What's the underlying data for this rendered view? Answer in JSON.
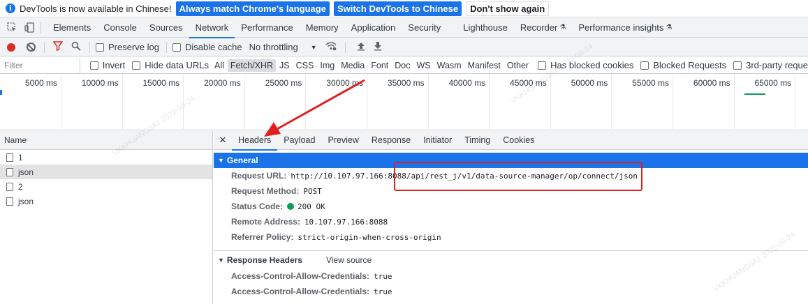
{
  "infobar": {
    "message": "DevTools is now available in Chinese!",
    "btn_match": "Always match Chrome's language",
    "btn_switch": "Switch DevTools to Chinese",
    "btn_dismiss": "Don't show again"
  },
  "tabs": [
    "Elements",
    "Console",
    "Sources",
    "Network",
    "Performance",
    "Memory",
    "Application",
    "Security",
    "Lighthouse",
    "Recorder",
    "Performance insights"
  ],
  "toolbar": {
    "preserve_log": "Preserve log",
    "disable_cache": "Disable cache",
    "throttling": "No throttling"
  },
  "filter": {
    "placeholder": "Filter",
    "invert": "Invert",
    "hide_data_urls": "Hide data URLs",
    "types": [
      "All",
      "Fetch/XHR",
      "JS",
      "CSS",
      "Img",
      "Media",
      "Font",
      "Doc",
      "WS",
      "Wasm",
      "Manifest",
      "Other"
    ],
    "has_blocked_cookies": "Has blocked cookies",
    "blocked_requests": "Blocked Requests",
    "third_party": "3rd-party reque"
  },
  "timeline": {
    "ticks": [
      "5000 ms",
      "10000 ms",
      "15000 ms",
      "20000 ms",
      "25000 ms",
      "30000 ms",
      "35000 ms",
      "40000 ms",
      "45000 ms",
      "50000 ms",
      "55000 ms",
      "60000 ms",
      "65000 ms"
    ]
  },
  "requests": {
    "header": "Name",
    "rows": [
      "1",
      "json",
      "2",
      "json"
    ]
  },
  "details": {
    "tabs": [
      "Headers",
      "Payload",
      "Preview",
      "Response",
      "Initiator",
      "Timing",
      "Cookies"
    ],
    "general": {
      "title": "General",
      "request_url_label": "Request URL:",
      "request_url": "http://10.107.97.166:8088/api/rest_j/v1/data-source-manager/op/connect/json",
      "method_label": "Request Method:",
      "method": "POST",
      "status_label": "Status Code:",
      "status": "200 OK",
      "remote_label": "Remote Address:",
      "remote": "10.107.97.166:8088",
      "referrer_label": "Referrer Policy:",
      "referrer": "strict-origin-when-cross-origin"
    },
    "response_headers": {
      "title": "Response Headers",
      "view_source": "View source",
      "rows": [
        {
          "k": "Access-Control-Allow-Credentials:",
          "v": "true"
        },
        {
          "k": "Access-Control-Allow-Credentials:",
          "v": "true"
        }
      ]
    }
  },
  "watermark": "VKKHUANG0A1 2022-06-24",
  "colors": {
    "accent": "#1a73e8",
    "annotation": "#e02020",
    "status_ok": "#0f9d58"
  }
}
